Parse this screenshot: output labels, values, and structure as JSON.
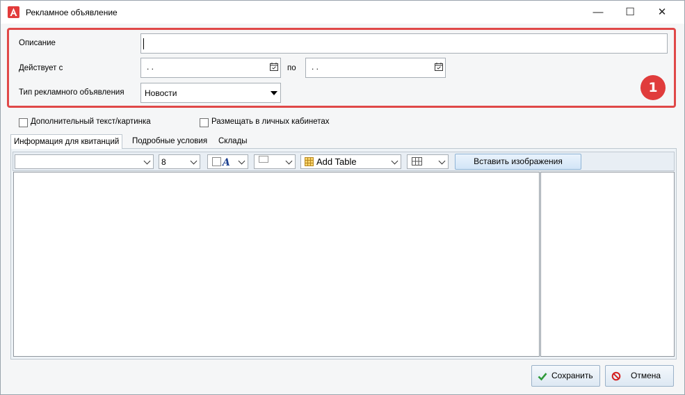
{
  "window": {
    "title": "Рекламное объявление",
    "controls": {
      "minimize": "—",
      "maximize": "☐",
      "close": "✕"
    }
  },
  "form": {
    "description_label": "Описание",
    "description_value": "",
    "valid_from_label": "Действует с",
    "valid_from_value": ". .",
    "valid_to_label": "по",
    "valid_to_value": ". .",
    "ad_type_label": "Тип рекламного объявления",
    "ad_type_value": "Новости",
    "annotation_badge": "1"
  },
  "options": {
    "extra_text_label": "Дополнительный текст/картинка",
    "extra_text_checked": false,
    "cabinets_label": "Размещать в личных кабинетах",
    "cabinets_checked": false
  },
  "tabs": [
    {
      "label": "Информация для квитанций",
      "active": true
    },
    {
      "label": "Подробные условия",
      "active": false
    },
    {
      "label": "Склады",
      "active": false
    }
  ],
  "toolbar": {
    "font_family_value": "",
    "font_size_value": "8",
    "add_table_label": "Add Table",
    "insert_images_label": "Вставить изображения"
  },
  "footer": {
    "save_label": "Сохранить",
    "cancel_label": "Отмена"
  },
  "colors": {
    "highlight": "#e04848",
    "badge": "#e03c3c",
    "save_check": "#2e9a3a",
    "cancel_icon": "#d42020"
  }
}
